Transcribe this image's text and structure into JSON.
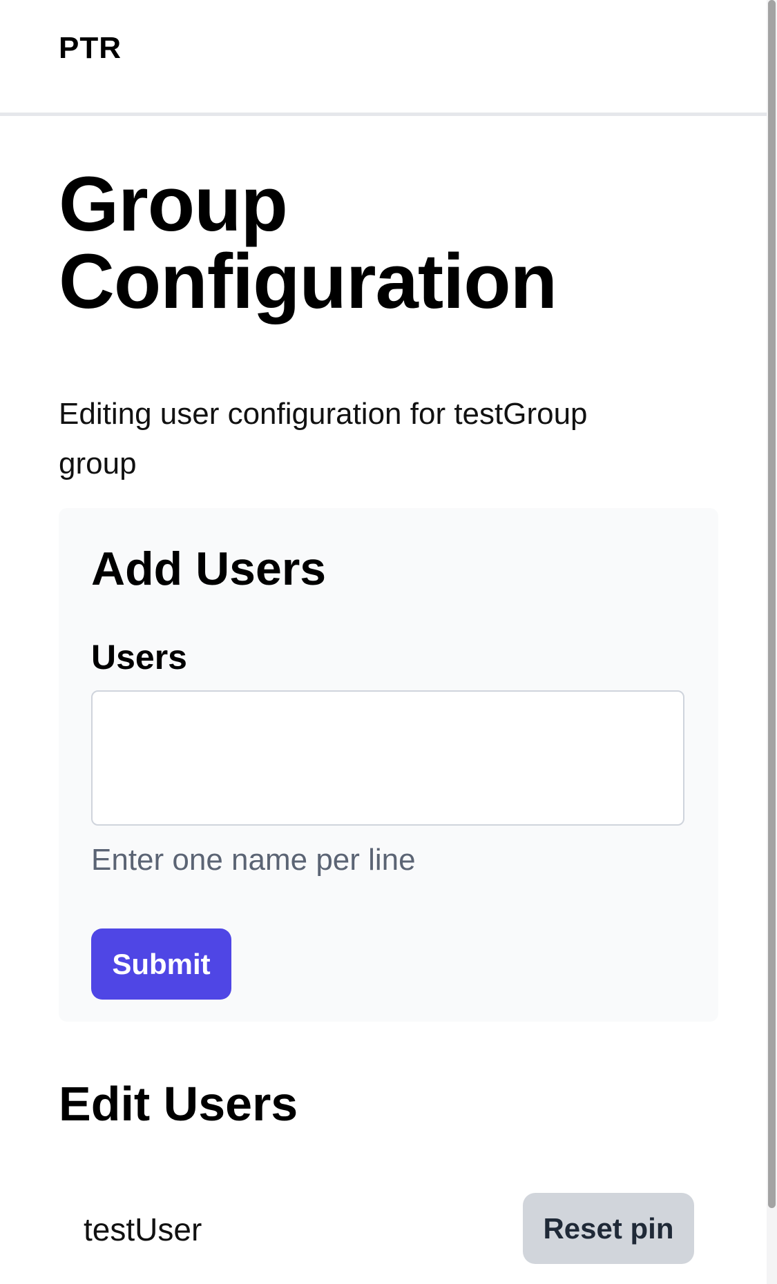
{
  "header": {
    "brand": "PTR"
  },
  "page": {
    "title": "Group Configuration",
    "description": "Editing user configuration for testGroup group"
  },
  "add_users": {
    "title": "Add Users",
    "field_label": "Users",
    "input_value": "",
    "helper_text": "Enter one name per line",
    "submit_label": "Submit"
  },
  "edit_users": {
    "title": "Edit Users",
    "rows": [
      {
        "name": "testUser",
        "action_label": "Reset pin"
      }
    ]
  },
  "colors": {
    "primary": "#4f46e5",
    "secondary_button": "#d1d5db",
    "panel_background": "#f9fafb",
    "divider": "#e5e7eb"
  }
}
